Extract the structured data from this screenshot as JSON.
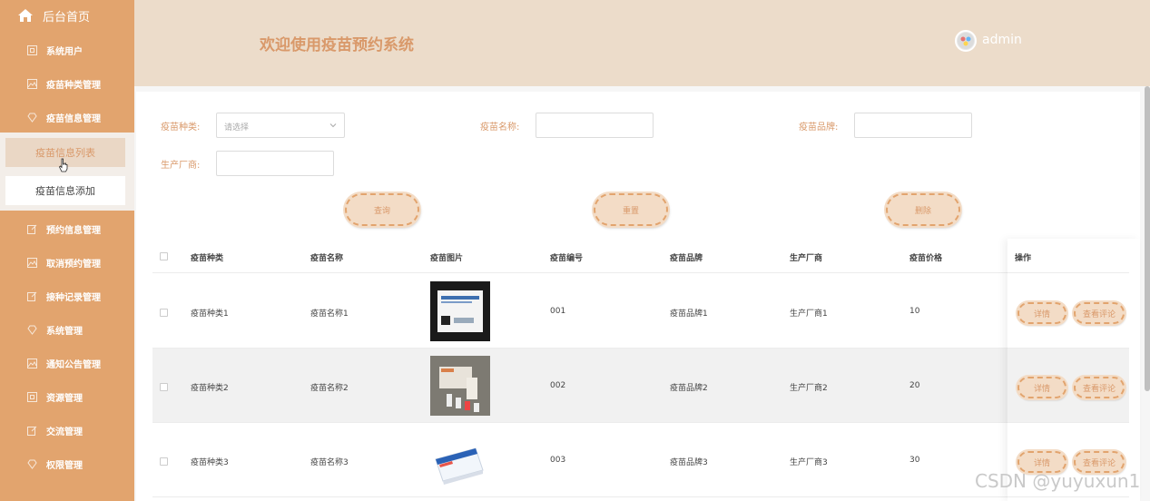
{
  "sidebar": {
    "home_label": "后台首页",
    "items": [
      {
        "label": "系统用户",
        "icon": "square-icon"
      },
      {
        "label": "疫苗种类管理",
        "icon": "image-icon"
      },
      {
        "label": "疫苗信息管理",
        "icon": "diamond-icon"
      },
      {
        "label": "预约信息管理",
        "icon": "edit-icon"
      },
      {
        "label": "取消预约管理",
        "icon": "image-icon"
      },
      {
        "label": "接种记录管理",
        "icon": "edit-icon"
      },
      {
        "label": "系统管理",
        "icon": "diamond-icon"
      },
      {
        "label": "通知公告管理",
        "icon": "image-icon"
      },
      {
        "label": "资源管理",
        "icon": "square-icon"
      },
      {
        "label": "交流管理",
        "icon": "edit-icon"
      },
      {
        "label": "权限管理",
        "icon": "diamond-icon"
      }
    ],
    "sub_items": [
      {
        "label": "疫苗信息列表"
      },
      {
        "label": "疫苗信息添加"
      }
    ]
  },
  "header": {
    "title": "欢迎使用疫苗预约系统",
    "user": "admin"
  },
  "filters": {
    "type_label": "疫苗种类:",
    "type_placeholder": "请选择",
    "name_label": "疫苗名称:",
    "brand_label": "疫苗品牌:",
    "maker_label": "生产厂商:"
  },
  "buttons": {
    "query": "查询",
    "reset": "重置",
    "delete": "删除"
  },
  "table": {
    "columns": [
      "疫苗种类",
      "疫苗名称",
      "疫苗图片",
      "疫苗编号",
      "疫苗品牌",
      "生产厂商",
      "疫苗价格",
      "操作"
    ],
    "rows": [
      {
        "type": "疫苗种类1",
        "name": "疫苗名称1",
        "code": "001",
        "brand": "疫苗品牌1",
        "maker": "生产厂商1",
        "price": "10"
      },
      {
        "type": "疫苗种类2",
        "name": "疫苗名称2",
        "code": "002",
        "brand": "疫苗品牌2",
        "maker": "生产厂商2",
        "price": "20"
      },
      {
        "type": "疫苗种类3",
        "name": "疫苗名称3",
        "code": "003",
        "brand": "疫苗品牌3",
        "maker": "生产厂商3",
        "price": "30"
      }
    ],
    "detail_label": "详情",
    "review_label": "查看评论"
  },
  "watermark": "CSDN @yuyuxun1",
  "colors": {
    "sidebar": "#e2a46e",
    "header": "#ecdcca",
    "accent": "#d9996a"
  }
}
